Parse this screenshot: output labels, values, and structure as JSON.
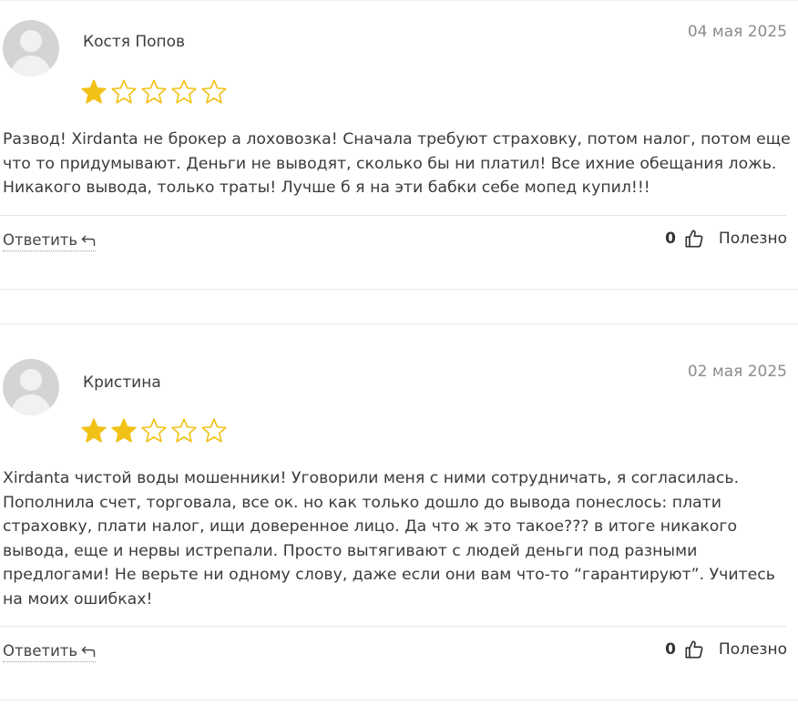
{
  "reviews": [
    {
      "author": "Костя Попов",
      "date": "04 мая 2025",
      "rating": 1,
      "max_rating": 5,
      "text": "Развод! Xirdanta не брокер а лоховозка! Сначала требуют страховку, потом налог, потом еще что то придумывают. Деньги не выводят, сколько бы ни платил! Все ихние обещания ложь. Никакого вывода, только траты! Лучше б я на эти бабки себе мопед купил!!!",
      "reply_label": "Ответить",
      "helpful_count": "0",
      "helpful_label": "Полезно"
    },
    {
      "author": "Кристина",
      "date": "02 мая 2025",
      "rating": 2,
      "max_rating": 5,
      "text": "Xirdanta чистой воды мошенники! Уговорили меня с ними сотрудничать, я согласилась. Пополнила счет, торговала, все ок. но как только дошло до вывода понеслось: плати страховку, плати налог, ищи доверенное лицо. Да что ж это такое??? в итоге никакого вывода, еще и нервы истрепали. Просто вытягивают с людей деньги под разными предлогами! Не верьте ни одному слову, даже если они вам что-то “гарантируют”. Учитесь на моих ошибках!",
      "reply_label": "Ответить",
      "helpful_count": "0",
      "helpful_label": "Полезно"
    }
  ],
  "colors": {
    "star_filled": "#f2c118",
    "star_empty_outline": "#f2c118",
    "avatar_bg": "#d4d4d4",
    "date_text": "#8c8c8c"
  },
  "icons": {
    "reply": "reply-arrow-icon",
    "helpful": "thumbs-up-icon",
    "rating": "star-icon",
    "avatar": "user-avatar-icon"
  }
}
